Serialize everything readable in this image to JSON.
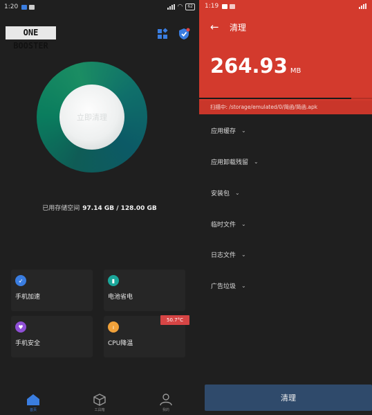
{
  "left": {
    "status": {
      "time": "1:20",
      "battery": "62"
    },
    "logo": "ONE BOOSTER",
    "circle_text": "立即清理",
    "storage": {
      "label": "已用存储空间",
      "value": "97.14 GB / 128.00 GB"
    },
    "features": [
      {
        "label": "手机加速",
        "icon": "rocket-icon",
        "color": "#3a7de0"
      },
      {
        "label": "电池省电",
        "icon": "battery-icon",
        "color": "#1aa69a"
      },
      {
        "label": "手机安全",
        "icon": "shield-icon",
        "color": "#8f4fd6"
      },
      {
        "label": "CPU降温",
        "icon": "thermometer-icon",
        "color": "#f0a13a"
      }
    ],
    "cpu_temp": "50.7°C",
    "nav": [
      {
        "label": "首页"
      },
      {
        "label": "工具箱"
      },
      {
        "label": "我的"
      }
    ],
    "accent": "#3a7de0"
  },
  "right": {
    "status": {
      "time": "1:19"
    },
    "title": "清理",
    "size": "264.93",
    "unit": "MB",
    "scan_path": "扫描中: /storage/emulated/0/简函/简函.apk",
    "progress": 0.88,
    "categories": [
      "应用缓存",
      "应用卸载残留",
      "安装包",
      "临时文件",
      "日志文件",
      "广告垃圾"
    ],
    "button": "清理",
    "header_color": "#d33a2d"
  }
}
